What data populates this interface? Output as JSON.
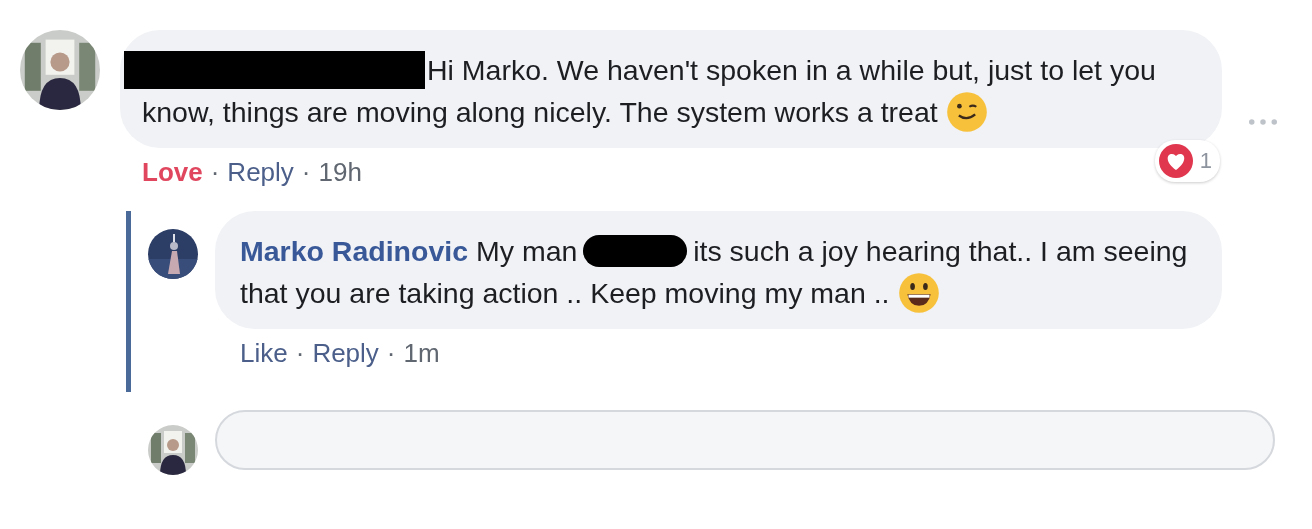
{
  "separator": "·",
  "comment": {
    "redacted_name": true,
    "text": "Hi Marko. We haven't spoken in a while but, just to let you know, things are moving along nicely. The system works a treat",
    "emoji": {
      "kind": "wink"
    },
    "reactions": {
      "count": "1"
    },
    "actions": [
      {
        "kind": "love",
        "label": "Love"
      },
      {
        "kind": "reply",
        "label": "Reply"
      },
      {
        "kind": "time",
        "label": "19h"
      }
    ]
  },
  "reply": {
    "author": "Marko Radinovic",
    "text_before": "My man",
    "redacted_mention": true,
    "text_after": "its such a joy hearing that.. I am seeing that you are taking action .. Keep moving my man ..",
    "emoji": {
      "kind": "grin"
    },
    "actions": [
      {
        "kind": "like",
        "label": "Like"
      },
      {
        "kind": "reply",
        "label": "Reply"
      },
      {
        "kind": "time",
        "label": "1m"
      }
    ]
  }
}
